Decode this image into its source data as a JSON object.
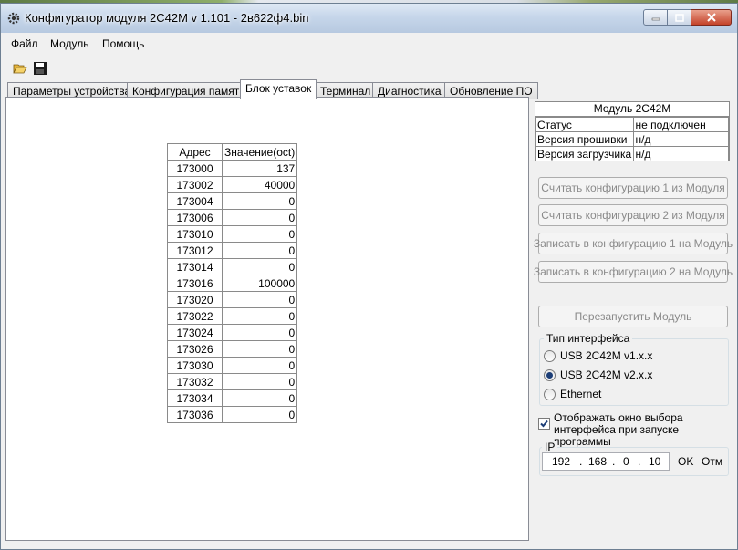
{
  "window": {
    "title": "Конфигуратор модуля 2С42М v 1.101 - 2в622ф4.bin"
  },
  "menu": [
    "Файл",
    "Модуль",
    "Помощь"
  ],
  "toolbar": {
    "open_icon": "folder-open-icon",
    "save_icon": "floppy-save-icon"
  },
  "tabs": [
    "Параметры устройства",
    "Конфигурация памяти",
    "Блок уставок",
    "Терминал",
    "Диагностика",
    "Обновление ПО"
  ],
  "active_tab": "Блок уставок",
  "table": {
    "headers": [
      "Адрес",
      "Значение(oct)"
    ],
    "rows": [
      [
        "173000",
        "137"
      ],
      [
        "173002",
        "40000"
      ],
      [
        "173004",
        "0"
      ],
      [
        "173006",
        "0"
      ],
      [
        "173010",
        "0"
      ],
      [
        "173012",
        "0"
      ],
      [
        "173014",
        "0"
      ],
      [
        "173016",
        "100000"
      ],
      [
        "173020",
        "0"
      ],
      [
        "173022",
        "0"
      ],
      [
        "173024",
        "0"
      ],
      [
        "173026",
        "0"
      ],
      [
        "173030",
        "0"
      ],
      [
        "173032",
        "0"
      ],
      [
        "173034",
        "0"
      ],
      [
        "173036",
        "0"
      ]
    ]
  },
  "module": {
    "title": "Модуль 2С42М",
    "status": [
      [
        "Статус",
        "не подключен"
      ],
      [
        "Версия прошивки",
        "н/д"
      ],
      [
        "Версия загрузчика",
        "н/д"
      ]
    ]
  },
  "buttons": {
    "read1": "Считать конфигурацию 1 из Модуля",
    "read2": "Считать конфигурацию 2 из Модуля",
    "write1": "Записать в конфигурацию 1 на Модуль",
    "write2": "Записать в конфигурацию 2 на Модуль",
    "restart": "Перезапустить Модуль"
  },
  "interface": {
    "title": "Тип интерфейса",
    "options": [
      "USB 2С42М v1.x.x",
      "USB 2С42М v2.x.x",
      "Ethernet"
    ],
    "selected": "USB 2С42М v2.x.x"
  },
  "show_dialog": {
    "line1": "Отображать окно выбора",
    "line2": "интерфейса при запуске программы",
    "checked": true
  },
  "ip": {
    "title": "IP",
    "octets": [
      "192",
      "168",
      "0",
      "10"
    ],
    "ok": "OK",
    "cancel": "Отм"
  }
}
